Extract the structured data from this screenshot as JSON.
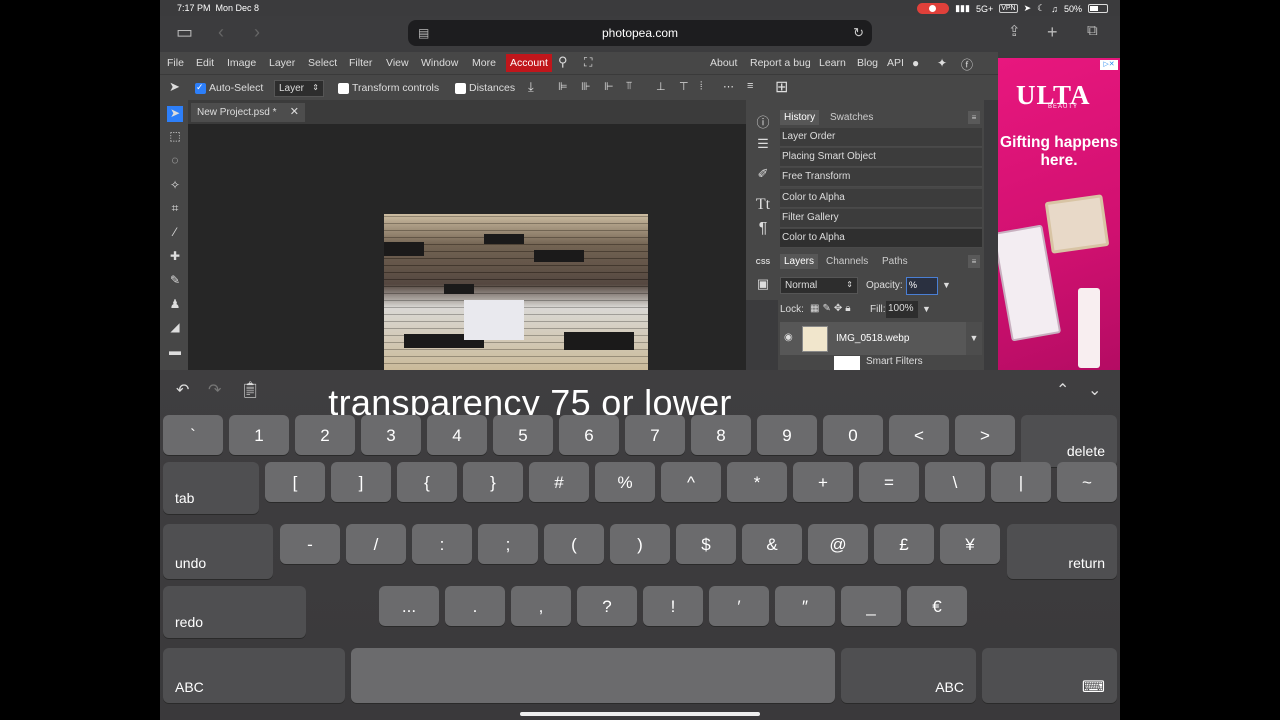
{
  "status": {
    "time": "7:17 PM",
    "date": "Mon Dec 8",
    "network": "5G+",
    "vpn": "VPN",
    "battery": "50%",
    "battery_level": 0.5
  },
  "browser": {
    "url": "photopea.com"
  },
  "menu": [
    "File",
    "Edit",
    "Image",
    "Layer",
    "Select",
    "Filter",
    "View",
    "Window",
    "More",
    "Account"
  ],
  "nav_links": [
    "About",
    "Report a bug",
    "Learn",
    "Blog",
    "API"
  ],
  "options": {
    "auto_select": "Auto-Select",
    "auto_select_checked": true,
    "layer_mode": "Layer",
    "transform_controls": "Transform controls",
    "distances": "Distances"
  },
  "document_tab": {
    "name": "New Project.psd *",
    "close": "✕"
  },
  "history": {
    "tabs": [
      "History",
      "Swatches"
    ],
    "items": [
      "Layer Order",
      "Placing Smart Object",
      "Free Transform",
      "Color to Alpha",
      "Filter Gallery",
      "Color to Alpha"
    ]
  },
  "layers": {
    "tabs": [
      "Layers",
      "Channels",
      "Paths"
    ],
    "blend_mode": "Normal",
    "opacity_label": "Opacity:",
    "opacity_value": "%",
    "lock_label": "Lock:",
    "fill_label": "Fill:",
    "fill_value": "100%",
    "layer_name": "IMG_0518.webp",
    "smart_filters": "Smart Filters"
  },
  "ad": {
    "brand": "ULTA",
    "sub": "BEAUTY",
    "tagline": "Gifting happens here.",
    "brand_color": "#e0177e"
  },
  "caption": "transparency 75 or lower",
  "keyboard": {
    "row1": [
      "`",
      "1",
      "2",
      "3",
      "4",
      "5",
      "6",
      "7",
      "8",
      "9",
      "0",
      "<",
      ">"
    ],
    "delete": "delete",
    "tab": "tab",
    "row2": [
      "[",
      "]",
      "{",
      "}",
      "#",
      "%",
      "^",
      "*",
      "+",
      "=",
      "\\",
      "|",
      "~"
    ],
    "undo": "undo",
    "row3": [
      "-",
      "/",
      ":",
      ";",
      "(",
      ")",
      "$",
      "&",
      "@",
      "£",
      "¥"
    ],
    "return": "return",
    "redo": "redo",
    "row4": [
      "...",
      ".",
      ",",
      "?",
      "!",
      "′",
      "″",
      "_",
      "€"
    ],
    "abc_left": "ABC",
    "abc_right": "ABC"
  }
}
